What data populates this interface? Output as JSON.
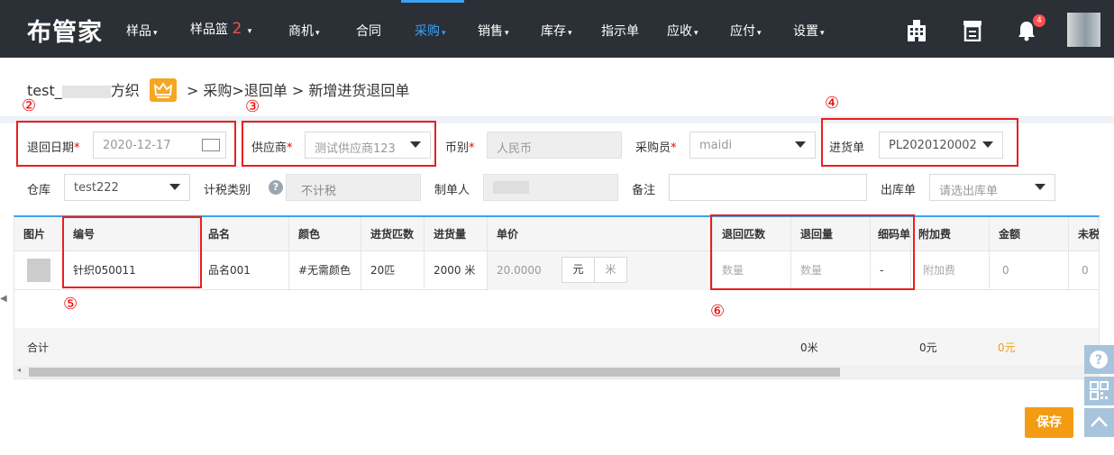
{
  "nav": {
    "logo": "布管家",
    "items": [
      {
        "label": "样品",
        "caret": "▾"
      },
      {
        "label": "样品篮",
        "badge": "2",
        "caret": "▾"
      },
      {
        "label": "商机",
        "caret": "▾"
      },
      {
        "label": "合同",
        "caret": ""
      },
      {
        "label": "采购",
        "caret": "▾"
      },
      {
        "label": "销售",
        "caret": "▾"
      },
      {
        "label": "库存",
        "caret": "▾"
      },
      {
        "label": "指示单",
        "caret": ""
      },
      {
        "label": "应收",
        "caret": "▾"
      },
      {
        "label": "应付",
        "caret": "▾"
      },
      {
        "label": "设置",
        "caret": "▾"
      }
    ],
    "notification_count": "4",
    "accent": "#3aa2f5"
  },
  "breadcrumb": {
    "company_prefix": "test_",
    "company_suffix": "方织",
    "path": "> 采购>退回单 > 新增进货退回单"
  },
  "annotations": [
    "②",
    "③",
    "④",
    "⑤",
    "⑥"
  ],
  "form": {
    "return_date_label": "退回日期",
    "return_date_value": "2020-12-17",
    "supplier_label": "供应商",
    "supplier_value": "测试供应商123",
    "currency_label": "币别",
    "currency_value": "人民币",
    "buyer_label": "采购员",
    "buyer_value": "maidi",
    "purchase_order_label": "进货单",
    "purchase_order_value": "PL2020120002",
    "warehouse_label": "仓库",
    "warehouse_value": "test222",
    "tax_type_label": "计税类别",
    "tax_type_value": "不计税",
    "maker_label": "制单人",
    "remark_label": "备注",
    "remark_value": "",
    "outbound_label": "出库单",
    "outbound_placeholder": "请选出库单",
    "required_mark": "*"
  },
  "table": {
    "headers": [
      "图片",
      "编号",
      "品名",
      "颜色",
      "进货匹数",
      "进货量",
      "单价",
      "退回匹数",
      "退回量",
      "细码单",
      "附加费",
      "金额",
      "未税"
    ],
    "row": {
      "code": "针织050011",
      "name": "品名001",
      "color": "#无需颜色",
      "in_pieces": "20匹",
      "in_qty": "2000 米",
      "unit_price": "20.0000",
      "unit_yuan": "元",
      "unit_meter": "米",
      "return_pieces_placeholder": "数量",
      "return_qty_placeholder": "数量",
      "detail_sheet": "-",
      "surcharge_placeholder": "附加费",
      "amount": "0",
      "untaxed": "0"
    },
    "summary": {
      "label": "合计",
      "return_qty": "0米",
      "surcharge": "0元",
      "amount": "0元"
    }
  },
  "save_label": "保存"
}
